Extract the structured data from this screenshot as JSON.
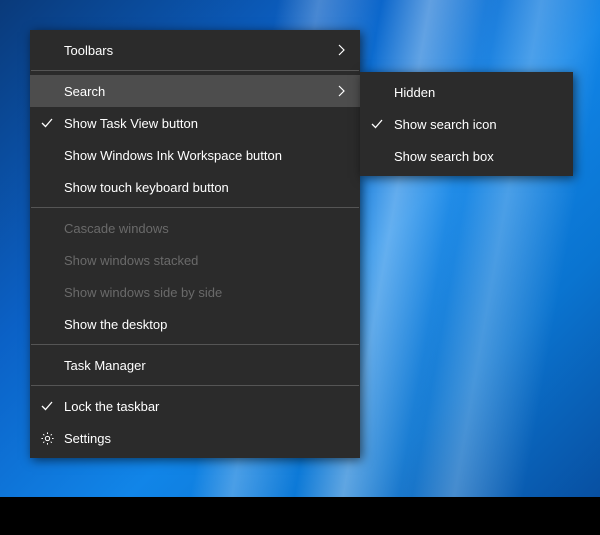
{
  "main_menu": {
    "toolbars": "Toolbars",
    "search": "Search",
    "show_task_view": "Show Task View button",
    "show_ink": "Show Windows Ink Workspace button",
    "show_touch_kb": "Show touch keyboard button",
    "cascade": "Cascade windows",
    "stacked": "Show windows stacked",
    "sidebyside": "Show windows side by side",
    "show_desktop": "Show the desktop",
    "task_manager": "Task Manager",
    "lock_taskbar": "Lock the taskbar",
    "settings": "Settings"
  },
  "sub_menu": {
    "hidden": "Hidden",
    "show_icon": "Show search icon",
    "show_box": "Show search box"
  }
}
